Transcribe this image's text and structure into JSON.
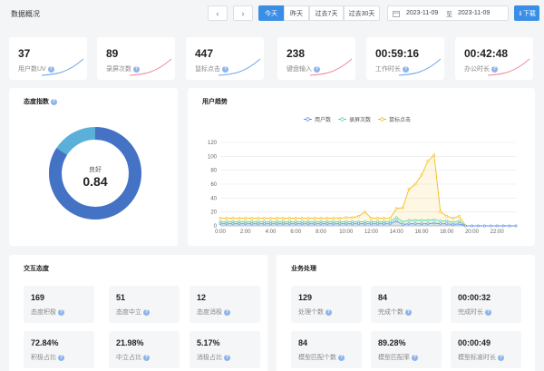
{
  "header": {
    "title": "数据概况",
    "prev_icon": "chevron-left-icon",
    "next_icon": "chevron-right-icon",
    "ranges": [
      "今天",
      "昨天",
      "过去7天",
      "过去30天"
    ],
    "active_range": "今天",
    "date_start": "2023-11-09",
    "date_sep": "至",
    "date_end": "2023-11-09",
    "download_label": "⇓下载",
    "accent": "#3a8ee6"
  },
  "stats": [
    {
      "value": "37",
      "label": "用户数UV",
      "spark_color": "#6aa6e8"
    },
    {
      "value": "89",
      "label": "录屏次数",
      "spark_color": "#f08a9c"
    },
    {
      "value": "447",
      "label": "鼠标点击",
      "spark_color": "#6aa6e8"
    },
    {
      "value": "238",
      "label": "键盘输入",
      "spark_color": "#f08a9c"
    },
    {
      "value": "00:59:16",
      "label": "工作时长",
      "spark_color": "#6aa6e8"
    },
    {
      "value": "00:42:48",
      "label": "办公时长",
      "spark_color": "#f08a9c"
    }
  ],
  "attitude": {
    "title": "态度指数",
    "center_label": "良好",
    "center_value": "0.84",
    "score": 0.84,
    "ring_color": "#4472c4",
    "rest_color": "#5ab0d8"
  },
  "trend": {
    "title": "用户趋势"
  },
  "chart_data": {
    "type": "line",
    "title": "用户趋势",
    "x": [
      "0:00",
      "0:30",
      "1:00",
      "1:30",
      "2:00",
      "2:30",
      "3:00",
      "3:30",
      "4:00",
      "4:30",
      "5:00",
      "5:30",
      "6:00",
      "6:30",
      "7:00",
      "7:30",
      "8:00",
      "8:30",
      "9:00",
      "9:30",
      "10:00",
      "10:30",
      "11:00",
      "11:30",
      "12:00",
      "12:30",
      "13:00",
      "13:30",
      "14:00",
      "14:30",
      "15:00",
      "15:30",
      "16:00",
      "16:30",
      "17:00",
      "17:30",
      "18:00",
      "18:30",
      "19:00",
      "19:30",
      "20:00",
      "20:30",
      "21:00",
      "21:30",
      "22:00",
      "22:30",
      "23:00",
      "23:30"
    ],
    "x_ticks": [
      "0:00",
      "2:00",
      "4:00",
      "6:00",
      "8:00",
      "10:00",
      "12:00",
      "14:00",
      "16:00",
      "18:00",
      "20:00",
      "22:00"
    ],
    "ylim": [
      0,
      120
    ],
    "y_ticks": [
      0,
      20,
      40,
      60,
      80,
      100,
      120
    ],
    "grid": true,
    "legend_position": "top-center",
    "series": [
      {
        "name": "用户数",
        "color": "#5b8ff9",
        "values": [
          3,
          3,
          3,
          3,
          3,
          3,
          3,
          3,
          3,
          3,
          3,
          3,
          3,
          3,
          3,
          3,
          3,
          3,
          3,
          3,
          3,
          3,
          3,
          3,
          3,
          3,
          3,
          3,
          7,
          2,
          3,
          3,
          3,
          3,
          4,
          3,
          3,
          2,
          3,
          0,
          0,
          0,
          0,
          0,
          0,
          0,
          0,
          0
        ]
      },
      {
        "name": "录屏次数",
        "color": "#5ad8a6",
        "values": [
          6,
          6,
          6,
          6,
          6,
          6,
          6,
          6,
          6,
          6,
          6,
          6,
          6,
          6,
          6,
          6,
          6,
          6,
          6,
          6,
          6,
          6,
          6,
          6,
          6,
          6,
          6,
          6,
          12,
          6,
          8,
          8,
          8,
          8,
          9,
          7,
          7,
          5,
          7,
          0,
          0,
          0,
          0,
          0,
          0,
          0,
          0,
          0
        ]
      },
      {
        "name": "鼠标点击",
        "color": "#f6bd16",
        "values": [
          11,
          11,
          11,
          11,
          11,
          11,
          11,
          11,
          11,
          11,
          11,
          11,
          11,
          11,
          11,
          11,
          11,
          11,
          11,
          11,
          12,
          12,
          14,
          20,
          11,
          11,
          11,
          11,
          25,
          26,
          53,
          60,
          73,
          93,
          102,
          20,
          14,
          11,
          14,
          0,
          0,
          0,
          0,
          0,
          0,
          0,
          0,
          0
        ]
      }
    ]
  },
  "interaction": {
    "title": "交互态度",
    "cards": [
      {
        "value": "169",
        "label": "态度积极"
      },
      {
        "value": "51",
        "label": "态度中立"
      },
      {
        "value": "12",
        "label": "态度消极"
      },
      {
        "value": "72.84%",
        "label": "积极占比"
      },
      {
        "value": "21.98%",
        "label": "中立占比"
      },
      {
        "value": "5.17%",
        "label": "消极占比"
      }
    ]
  },
  "business": {
    "title": "业务处理",
    "cards": [
      {
        "value": "129",
        "label": "处理个数"
      },
      {
        "value": "84",
        "label": "完成个数"
      },
      {
        "value": "00:00:32",
        "label": "完成时长"
      },
      {
        "value": "84",
        "label": "模型匹配个数"
      },
      {
        "value": "89.28%",
        "label": "模型匹配率"
      },
      {
        "value": "00:00:49",
        "label": "模型标准时长"
      }
    ]
  }
}
